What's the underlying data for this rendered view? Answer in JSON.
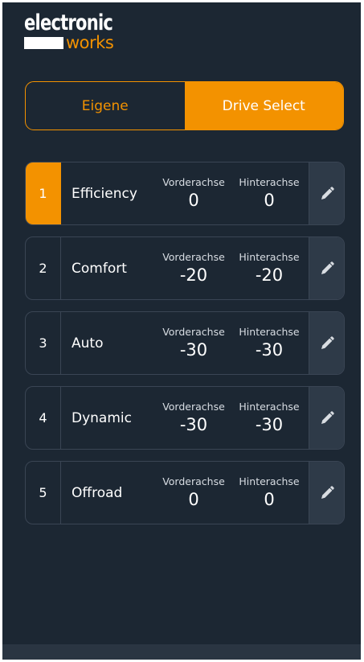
{
  "brand": {
    "line1": "electronic",
    "line2": "works"
  },
  "toggle": {
    "options": [
      "Eigene",
      "Drive Select"
    ],
    "active_index": 1
  },
  "axle_labels": {
    "front": "Vorderachse",
    "rear": "Hinterachse"
  },
  "modes": [
    {
      "number": "1",
      "name": "Efficiency",
      "front": "0",
      "rear": "0",
      "selected": true
    },
    {
      "number": "2",
      "name": "Comfort",
      "front": "-20",
      "rear": "-20",
      "selected": false
    },
    {
      "number": "3",
      "name": "Auto",
      "front": "-30",
      "rear": "-30",
      "selected": false
    },
    {
      "number": "4",
      "name": "Dynamic",
      "front": "-30",
      "rear": "-30",
      "selected": false
    },
    {
      "number": "5",
      "name": "Offroad",
      "front": "0",
      "rear": "0",
      "selected": false
    }
  ],
  "icons": {
    "edit": "pencil-icon"
  },
  "colors": {
    "accent": "#f39200",
    "background": "#1c2733",
    "card_border": "#3a4554",
    "edit_bg": "#2e3a48"
  }
}
